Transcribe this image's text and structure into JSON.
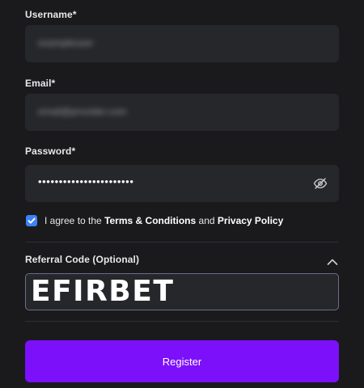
{
  "form": {
    "username": {
      "label": "Username*",
      "value": "exampleuser"
    },
    "email": {
      "label": "Email*",
      "value": "email@provider.com"
    },
    "password": {
      "label": "Password*",
      "value": "•••••••••••••••••••••••",
      "toggle_icon": "eye-off-icon"
    },
    "agreement": {
      "checked": true,
      "prefix": "I agree to the ",
      "terms_link": "Terms & Conditions",
      "middle": " and ",
      "privacy_link": "Privacy Policy"
    },
    "referral": {
      "label": "Referral Code (Optional)",
      "value": "EFIRBET",
      "expanded": true,
      "toggle_icon": "chevron-up-icon"
    },
    "submit_label": "Register"
  },
  "colors": {
    "background": "#1a1a1d",
    "field": "#26272b",
    "checkbox": "#3b82f6",
    "primary_button": "#7c10fa"
  }
}
